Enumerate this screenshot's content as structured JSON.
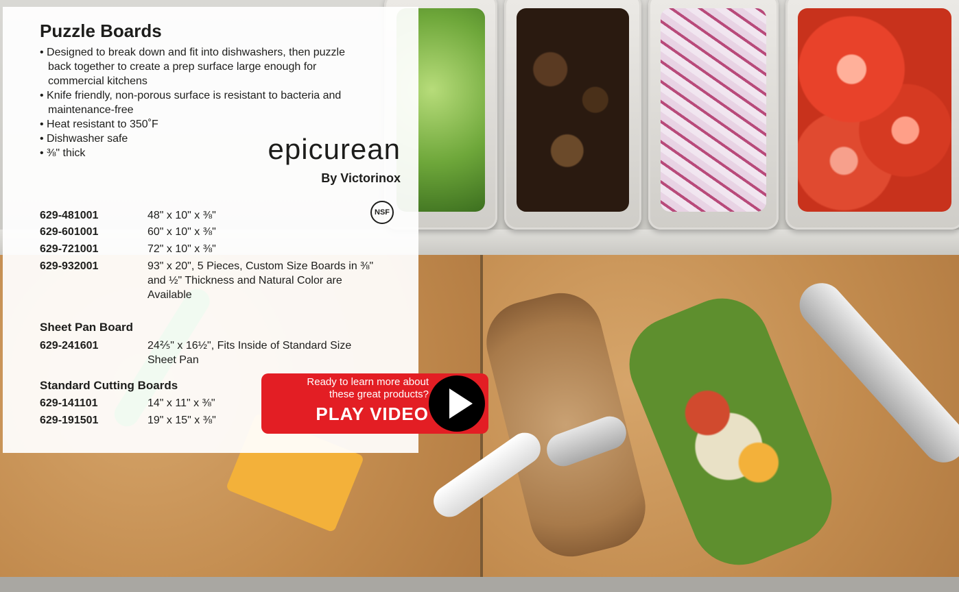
{
  "product": {
    "title": "Puzzle Boards",
    "bullets": [
      "Designed to break down and fit into dishwashers, then puzzle back together to create a prep surface large enough for commercial kitchens",
      "Knife friendly, non-porous surface is resistant to bacteria and maintenance-free",
      "Heat resistant to 350˚F",
      "Dishwasher safe",
      "⅜\" thick"
    ]
  },
  "brand": {
    "name": "epicurean",
    "tagline": "By Victorinox",
    "certification": "NSF"
  },
  "puzzle_items": [
    {
      "sku": "629-481001",
      "desc": "48\" x 10\" x ⅜\""
    },
    {
      "sku": "629-601001",
      "desc": "60\" x 10\" x ⅜\""
    },
    {
      "sku": "629-721001",
      "desc": "72\" x 10\" x ⅜\""
    },
    {
      "sku": "629-932001",
      "desc": "93\" x 20\", 5 Pieces, Custom Size Boards in ⅜\" and ½\" Thickness and Natural Color are Available"
    }
  ],
  "sheet_pan": {
    "heading": "Sheet Pan Board",
    "items": [
      {
        "sku": "629-241601",
        "desc": "24⅖\" x 16½\", Fits Inside of  Standard Size Sheet Pan"
      }
    ]
  },
  "standard": {
    "heading": "Standard Cutting Boards",
    "items": [
      {
        "sku": "629-141101",
        "desc": "14\" x 11\" x ⅜\""
      },
      {
        "sku": "629-191501",
        "desc": "19\" x 15\" x ⅜\""
      }
    ]
  },
  "video": {
    "line1": "Ready to learn more about",
    "line2": "these great products?",
    "cta": "PLAY VIDEO",
    "icon": "play-icon"
  },
  "colors": {
    "video_red": "#e31e24",
    "text": "#1d1d1b"
  }
}
